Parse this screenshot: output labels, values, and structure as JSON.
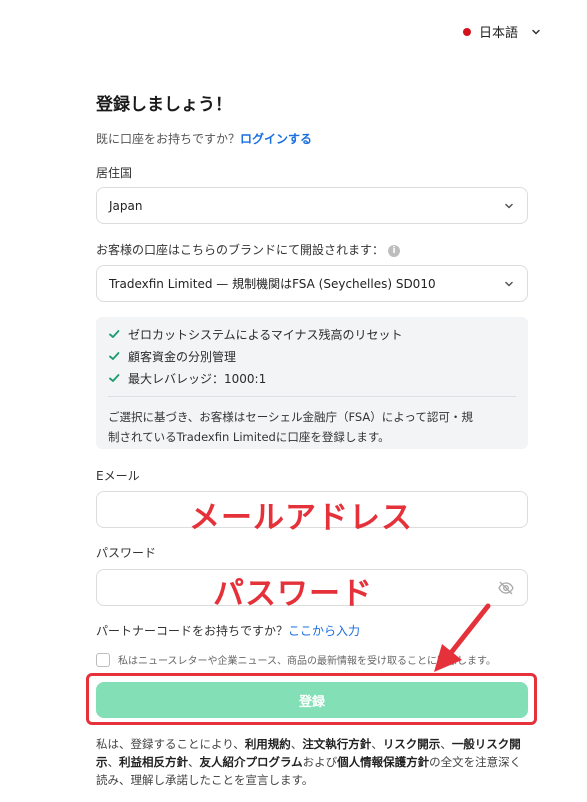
{
  "language": {
    "label": "日本語"
  },
  "header": {
    "title": "登録しましょう！",
    "login_prompt": "既に口座をお持ちですか？",
    "login_link": "ログインする"
  },
  "residence": {
    "label": "居住国",
    "value": "Japan"
  },
  "brand": {
    "label": "お客様の口座はこちらのブランドにて開設されます：",
    "value": "Tradexfin Limited — 規制機関はFSA (Seychelles) SD010"
  },
  "features": {
    "items": [
      "ゼロカットシステムによるマイナス残高のリセット",
      "顧客資金の分別管理",
      "最大レバレッジ：1000:1"
    ],
    "note_line1": "ご選択に基づき、お客様はセーシェル金融庁（FSA）によって認可・規",
    "note_line2": "制されているTradexfin Limitedに口座を登録します。"
  },
  "email": {
    "label": "Eメール",
    "overlay": "メールアドレス"
  },
  "password": {
    "label": "パスワード",
    "overlay": "パスワード"
  },
  "partner": {
    "prompt": "パートナーコードをお持ちですか？",
    "link": "ここから入力"
  },
  "consent": {
    "text": "私はニュースレターや企業ニュース、商品の最新情報を受け取ることに同意します。"
  },
  "submit": {
    "label": "登録"
  },
  "terms": {
    "t1": "私は、登録することにより、",
    "b1": "利用規約",
    "s1": "、",
    "b2": "注文執行方針",
    "s2": "、",
    "b3": "リスク開示",
    "s3": "、",
    "b4": "一般リスク開示",
    "s4": "、",
    "b5": "利益相反方針",
    "s5": "、",
    "b6": "友人紹介プログラム",
    "t2": "および",
    "b7": "個人情報保護方針",
    "t3": "の全文を注意深く読み、理解し承諾したことを宣言します。"
  },
  "colors": {
    "accent_link": "#1a6fe0",
    "submit_bg": "#83dfb5",
    "annotation_red": "#e5323a",
    "check_green": "#1a9c6b"
  }
}
